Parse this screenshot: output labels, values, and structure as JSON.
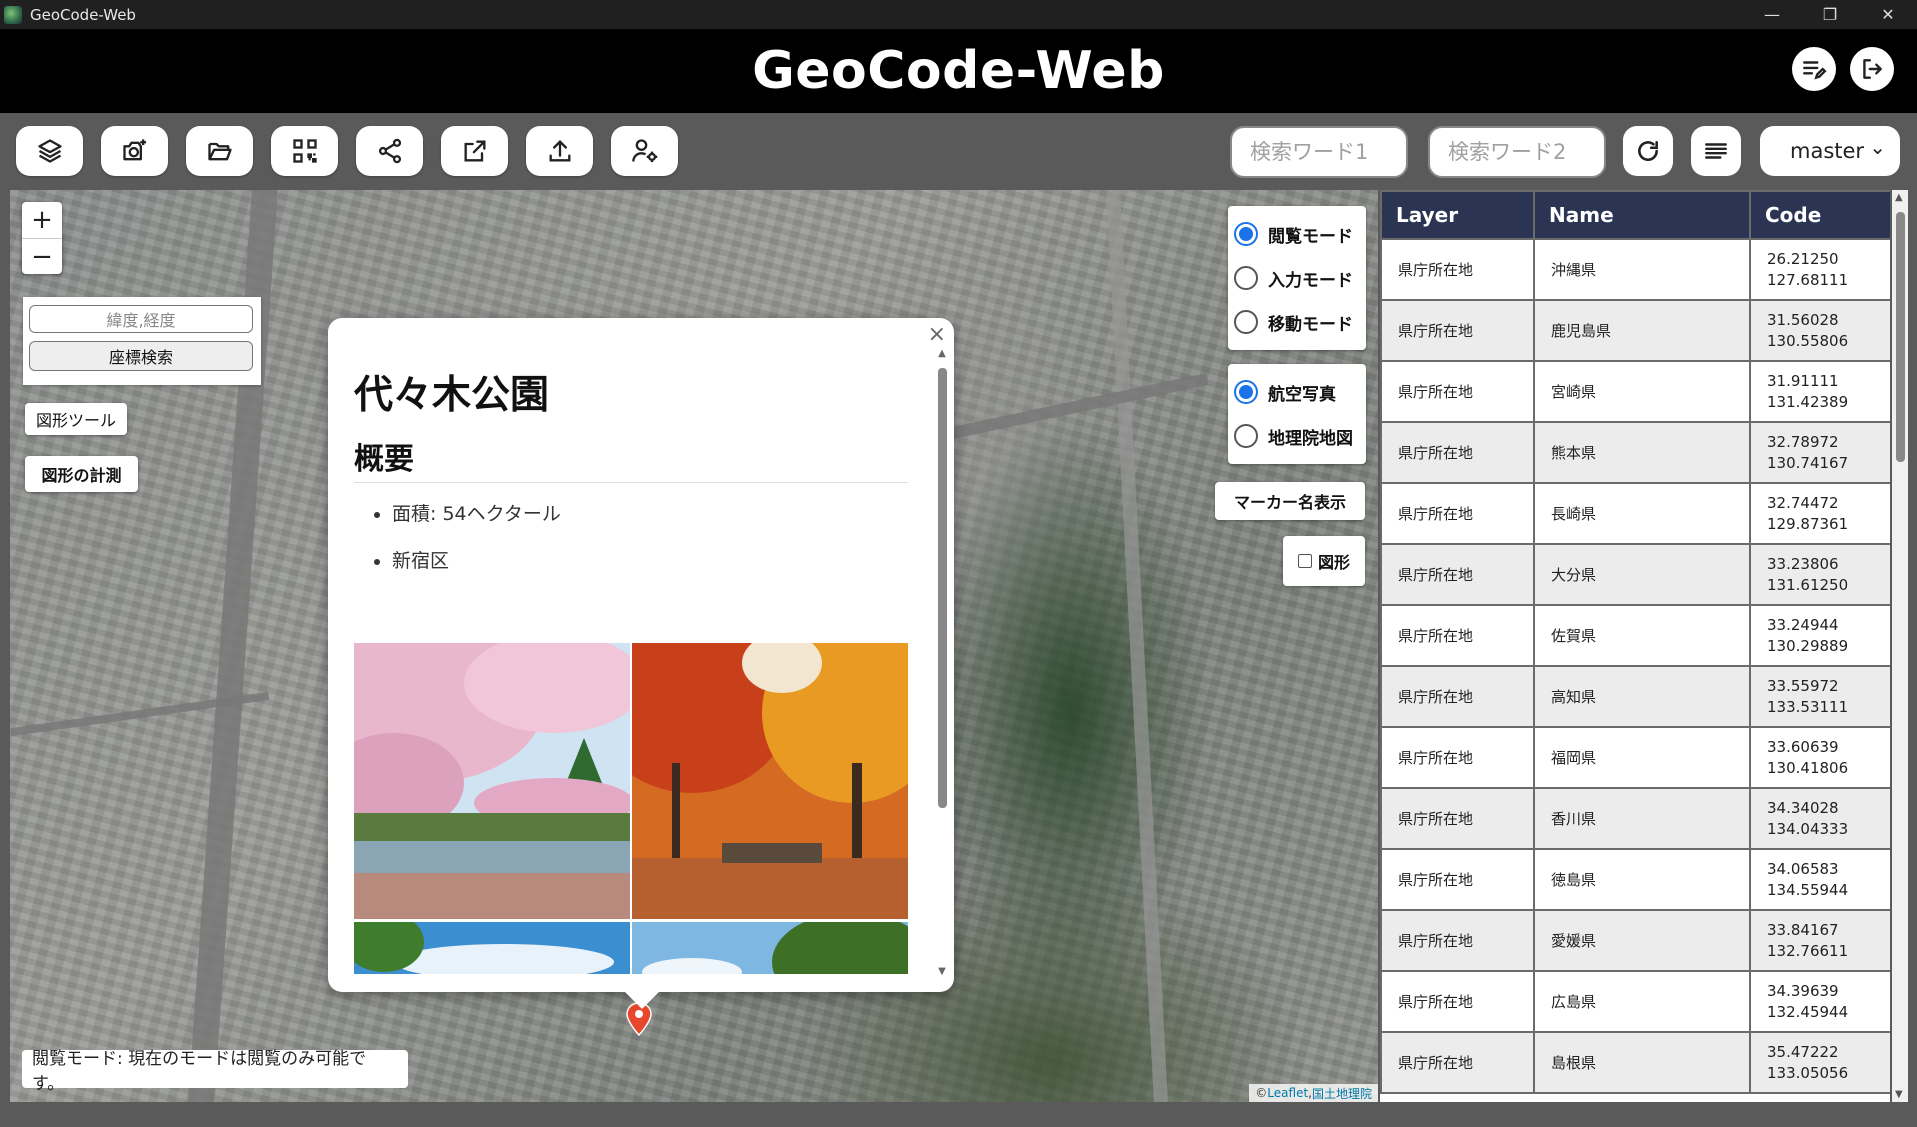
{
  "window": {
    "title": "GeoCode-Web",
    "minimize": "—",
    "maximize": "❐",
    "close": "✕"
  },
  "header": {
    "title": "GeoCode-Web"
  },
  "toolbar": {
    "search1_placeholder": "検索ワード1",
    "search2_placeholder": "検索ワード2",
    "branch": "master",
    "branch_chevron": "⌄"
  },
  "map": {
    "zoom_in": "+",
    "zoom_out": "−",
    "coord_placeholder": "緯度,経度",
    "coord_search": "座標検索",
    "shape_tool": "図形ツール",
    "shape_measure": "図形の計測",
    "modes": [
      "閲覧モード",
      "入力モード",
      "移動モード"
    ],
    "selected_mode": 0,
    "basemaps": [
      "航空写真",
      "地理院地図"
    ],
    "selected_basemap": 0,
    "marker_names": "マーカー名表示",
    "shape_checkbox": "図形",
    "status": "閲覧モード: 現在のモードは閲覧のみ可能です。",
    "attribution_prefix": "© ",
    "attribution_leaflet": "Leaflet",
    "attribution_sep": ", ",
    "attribution_gsi": "国土地理院"
  },
  "popup": {
    "close": "×",
    "title": "代々木公園",
    "section": "概要",
    "items": [
      "面積: 54ヘクタール",
      "新宿区"
    ]
  },
  "table": {
    "headers": [
      "Layer",
      "Name",
      "Code"
    ],
    "rows": [
      {
        "layer": "県庁所在地",
        "name": "沖縄県",
        "lat": "26.21250",
        "lng": "127.68111"
      },
      {
        "layer": "県庁所在地",
        "name": "鹿児島県",
        "lat": "31.56028",
        "lng": "130.55806"
      },
      {
        "layer": "県庁所在地",
        "name": "宮崎県",
        "lat": "31.91111",
        "lng": "131.42389"
      },
      {
        "layer": "県庁所在地",
        "name": "熊本県",
        "lat": "32.78972",
        "lng": "130.74167"
      },
      {
        "layer": "県庁所在地",
        "name": "長崎県",
        "lat": "32.74472",
        "lng": "129.87361"
      },
      {
        "layer": "県庁所在地",
        "name": "大分県",
        "lat": "33.23806",
        "lng": "131.61250"
      },
      {
        "layer": "県庁所在地",
        "name": "佐賀県",
        "lat": "33.24944",
        "lng": "130.29889"
      },
      {
        "layer": "県庁所在地",
        "name": "高知県",
        "lat": "33.55972",
        "lng": "133.53111"
      },
      {
        "layer": "県庁所在地",
        "name": "福岡県",
        "lat": "33.60639",
        "lng": "130.41806"
      },
      {
        "layer": "県庁所在地",
        "name": "香川県",
        "lat": "34.34028",
        "lng": "134.04333"
      },
      {
        "layer": "県庁所在地",
        "name": "徳島県",
        "lat": "34.06583",
        "lng": "134.55944"
      },
      {
        "layer": "県庁所在地",
        "name": "愛媛県",
        "lat": "33.84167",
        "lng": "132.76611"
      },
      {
        "layer": "県庁所在地",
        "name": "広島県",
        "lat": "34.39639",
        "lng": "132.45944"
      },
      {
        "layer": "県庁所在地",
        "name": "島根県",
        "lat": "35.47222",
        "lng": "133.05056"
      }
    ]
  },
  "colors": {
    "header_bg": "#000000",
    "table_header": "#2b3553",
    "accent": "#1a73e8",
    "toolbar_bg": "#5a5a5a"
  },
  "icons": [
    "layers-icon",
    "camera-add-icon",
    "folder-open-icon",
    "qr-code-icon",
    "share-icon",
    "external-link-icon",
    "upload-icon",
    "user-settings-icon",
    "edit-list-icon",
    "logout-icon",
    "refresh-icon",
    "menu-icon",
    "map-marker-icon"
  ]
}
